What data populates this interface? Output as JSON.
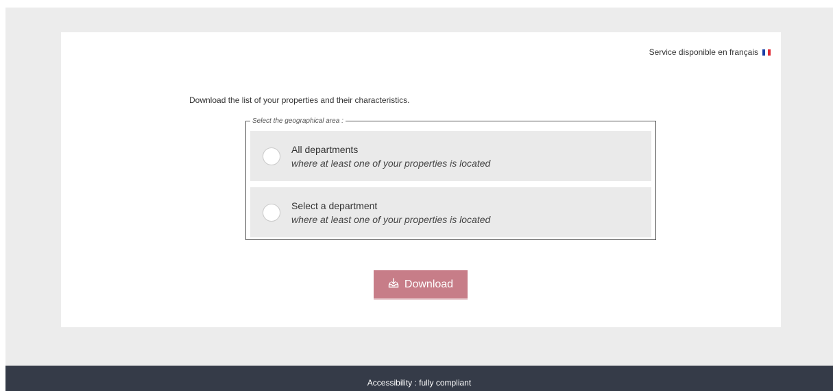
{
  "header": {
    "language_link": "Service disponible en français",
    "flag_icon": "france-flag-icon"
  },
  "main": {
    "intro": "Download the list of your properties and their characteristics.",
    "area_selector": {
      "legend": "Select the geographical area :",
      "options": [
        {
          "title": "All departments",
          "subtitle": "where at least one of your properties is located"
        },
        {
          "title": "Select a department",
          "subtitle": "where at least one of your properties is located"
        }
      ]
    },
    "download_button": {
      "label": "Download",
      "icon": "download-tray-icon"
    }
  },
  "footer": {
    "accessibility": "Accessibility : fully compliant"
  },
  "colors": {
    "button": "#c77d88",
    "footer": "#353b48",
    "page_background": "#ececec"
  }
}
